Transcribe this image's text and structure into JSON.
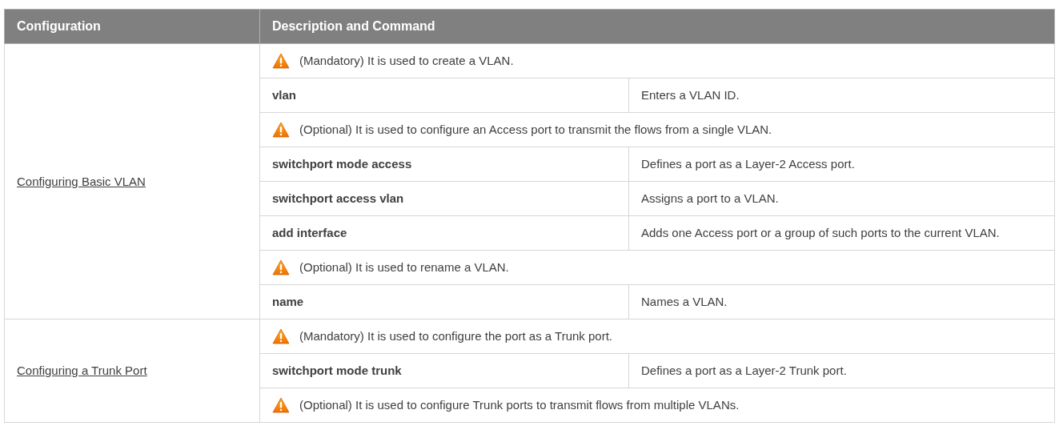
{
  "table": {
    "columns": [
      "Configuration",
      "Description and Command"
    ],
    "groups": [
      {
        "configuration": "Configuring Basic VLAN",
        "rows": [
          {
            "kind": "note",
            "text": "(Mandatory) It is used to create a VLAN."
          },
          {
            "kind": "command",
            "command": "vlan",
            "description": "Enters a VLAN ID."
          },
          {
            "kind": "note",
            "text": "(Optional) It is used to configure an Access port to transmit the flows from a single VLAN."
          },
          {
            "kind": "command",
            "command": "switchport mode access",
            "description": "Defines a port as a Layer-2 Access port."
          },
          {
            "kind": "command",
            "command": "switchport access vlan",
            "description": "Assigns a port to a VLAN."
          },
          {
            "kind": "command",
            "command": "add interface",
            "description": "Adds one Access port or a group of such ports to the current VLAN."
          },
          {
            "kind": "note",
            "text": "(Optional) It is used to rename a VLAN."
          },
          {
            "kind": "command",
            "command": "name",
            "description": "Names a VLAN."
          }
        ]
      },
      {
        "configuration": "Configuring a Trunk Port",
        "rows": [
          {
            "kind": "note",
            "text": "(Mandatory) It is used to configure the port as a Trunk port."
          },
          {
            "kind": "command",
            "command": "switchport mode trunk",
            "description": "Defines a port as a Layer-2 Trunk port."
          },
          {
            "kind": "note",
            "text": "(Optional) It is used to configure Trunk ports to transmit flows from multiple VLANs."
          }
        ]
      }
    ]
  }
}
